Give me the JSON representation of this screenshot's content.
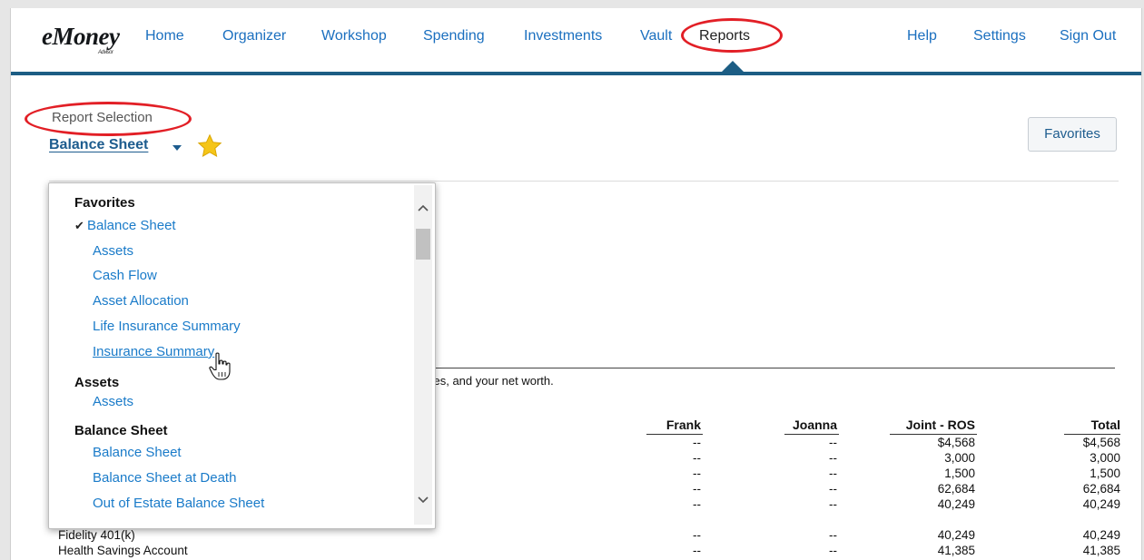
{
  "nav": {
    "logo": "eMoney",
    "logo_sub": "Advisor",
    "items": [
      "Home",
      "Organizer",
      "Workshop",
      "Spending",
      "Investments",
      "Vault",
      "Reports",
      "Help",
      "Settings",
      "Sign Out"
    ],
    "active": "Reports"
  },
  "report": {
    "selection_label": "Report Selection",
    "current": "Balance Sheet",
    "favorites_button": "Favorites",
    "description_tail": "ties, and your net worth."
  },
  "dropdown": {
    "groups": [
      {
        "heading": "Favorites",
        "items": [
          "Balance Sheet",
          "Assets",
          "Cash Flow",
          "Asset Allocation",
          "Life Insurance Summary",
          "Insurance Summary"
        ]
      },
      {
        "heading": "Assets",
        "items": [
          "Assets"
        ]
      },
      {
        "heading": "Balance Sheet",
        "items": [
          "Balance Sheet",
          "Balance Sheet at Death",
          "Out of Estate Balance Sheet"
        ]
      }
    ],
    "checked_item": "Balance Sheet",
    "hovered_item": "Insurance Summary"
  },
  "table": {
    "columns": [
      "Frank",
      "Joanna",
      "Joint - ROS",
      "Total"
    ],
    "rows": [
      {
        "label": "",
        "values": [
          "--",
          "--",
          "$4,568",
          "$4,568"
        ]
      },
      {
        "label": "",
        "values": [
          "--",
          "--",
          "3,000",
          "3,000"
        ]
      },
      {
        "label": "",
        "values": [
          "--",
          "--",
          "1,500",
          "1,500"
        ]
      },
      {
        "label": "",
        "values": [
          "--",
          "--",
          "62,684",
          "62,684"
        ]
      },
      {
        "label": "",
        "values": [
          "--",
          "--",
          "40,249",
          "40,249"
        ]
      },
      {
        "label": "Fidelity 401(k)",
        "values": [
          "--",
          "--",
          "40,249",
          "40,249"
        ]
      },
      {
        "label": "Health Savings Account",
        "values": [
          "--",
          "--",
          "41,385",
          "41,385"
        ]
      }
    ]
  },
  "colors": {
    "nav_link": "#1a6fbf",
    "nav_bar": "#1c5d84",
    "highlight_oval": "#e21f26",
    "dropdown_link": "#1a7bc9",
    "star": "#f5c518"
  }
}
